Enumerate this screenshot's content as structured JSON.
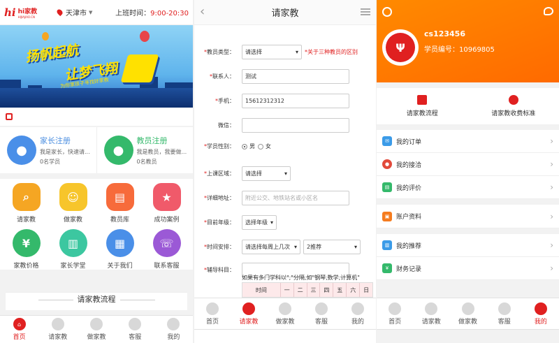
{
  "home": {
    "logo_mark": "hi",
    "logo_name": "hi家教",
    "logo_url": "HIJIAJIAO.CN",
    "city": "天津市",
    "hours_label": "上班时间：",
    "hours_value": "9:00-20:30",
    "banner_line1": "扬帆起航",
    "banner_line2": "让梦飞翔",
    "banner_sub": "为你家孩子寻找好家教",
    "parent_register": {
      "title": "家长注册",
      "desc": "我是家长，快速请...",
      "count": "0名学员"
    },
    "teacher_register": {
      "title": "教员注册",
      "desc": "我是教员，我要做...",
      "count": "0名教员"
    },
    "grid": [
      {
        "label": "请家教",
        "icon": "search-person-icon",
        "color": "#f5a623"
      },
      {
        "label": "做家教",
        "icon": "group-icon",
        "color": "#f7c52b"
      },
      {
        "label": "教员库",
        "icon": "library-icon",
        "color": "#f76b3b"
      },
      {
        "label": "成功案例",
        "icon": "case-icon",
        "color": "#f05a6a"
      },
      {
        "label": "家教价格",
        "icon": "yuan-icon",
        "color": "#34b96b"
      },
      {
        "label": "家长学堂",
        "icon": "book-icon",
        "color": "#3cc7a0"
      },
      {
        "label": "关于我们",
        "icon": "building-icon",
        "color": "#4a8fe8"
      },
      {
        "label": "联系客服",
        "icon": "headset-icon",
        "color": "#9b59d6"
      }
    ],
    "flow_title": "请家教流程"
  },
  "tabs_home": [
    {
      "label": "首页",
      "active": true
    },
    {
      "label": "请家教",
      "active": false
    },
    {
      "label": "做家教",
      "active": false
    },
    {
      "label": "客服",
      "active": false
    },
    {
      "label": "我的",
      "active": false
    }
  ],
  "form": {
    "title": "请家教",
    "teacher_type_label": "教员类型：",
    "teacher_type_value": "请选择",
    "teacher_type_note": "*关于三种教员的区别",
    "contact_label": "联系人：",
    "contact_value": "测试",
    "phone_label": "手机：",
    "phone_value": "15612312312",
    "wechat_label": "微信：",
    "wechat_value": "",
    "gender_label": "学员性别：",
    "gender_male": "男",
    "gender_female": "女",
    "area_label": "上课区域：",
    "area_value": "请选择",
    "address_label": "详细地址：",
    "address_placeholder": "附近公交、地铁站名或小区名",
    "grade_label": "目前年级：",
    "grade_value": "选择年级",
    "schedule_label": "时间安排：",
    "schedule_value": "请选择每周上几次",
    "schedule_value2": "2推荐",
    "subject_label": "辅导科目：",
    "subject_hint": "如果有多门学科以\",\"分隔,如\"钢琴,数学,计算机\"",
    "table_head": [
      "时间",
      "一",
      "二",
      "三",
      "四",
      "五",
      "六",
      "日"
    ]
  },
  "tabs_form": [
    {
      "label": "首页",
      "active": false
    },
    {
      "label": "请家教",
      "active": true
    },
    {
      "label": "做家教",
      "active": false
    },
    {
      "label": "客服",
      "active": false
    },
    {
      "label": "我的",
      "active": false
    }
  ],
  "profile": {
    "username": "cs123456",
    "student_id": "学员编号：10969805",
    "quick": [
      {
        "label": "请家教流程",
        "icon": "flowchart-icon"
      },
      {
        "label": "请家教收费标准",
        "icon": "moneybag-icon"
      }
    ],
    "menu1": [
      {
        "label": "我的订单",
        "icon": "order-icon",
        "color": "#3b9be8"
      },
      {
        "label": "我的接洽",
        "icon": "people-icon",
        "color": "#e24a3b"
      },
      {
        "label": "我的评价",
        "icon": "review-icon",
        "color": "#34b96b"
      }
    ],
    "menu2": [
      {
        "label": "账户资料",
        "icon": "account-icon",
        "color": "#f57c1f"
      }
    ],
    "menu3": [
      {
        "label": "我的推荐",
        "icon": "recommend-icon",
        "color": "#3b9be8"
      },
      {
        "label": "财务记录",
        "icon": "finance-icon",
        "color": "#34b96b"
      }
    ]
  },
  "tabs_profile": [
    {
      "label": "首页",
      "active": false
    },
    {
      "label": "请家教",
      "active": false
    },
    {
      "label": "做家教",
      "active": false
    },
    {
      "label": "客服",
      "active": false
    },
    {
      "label": "我的",
      "active": true
    }
  ]
}
